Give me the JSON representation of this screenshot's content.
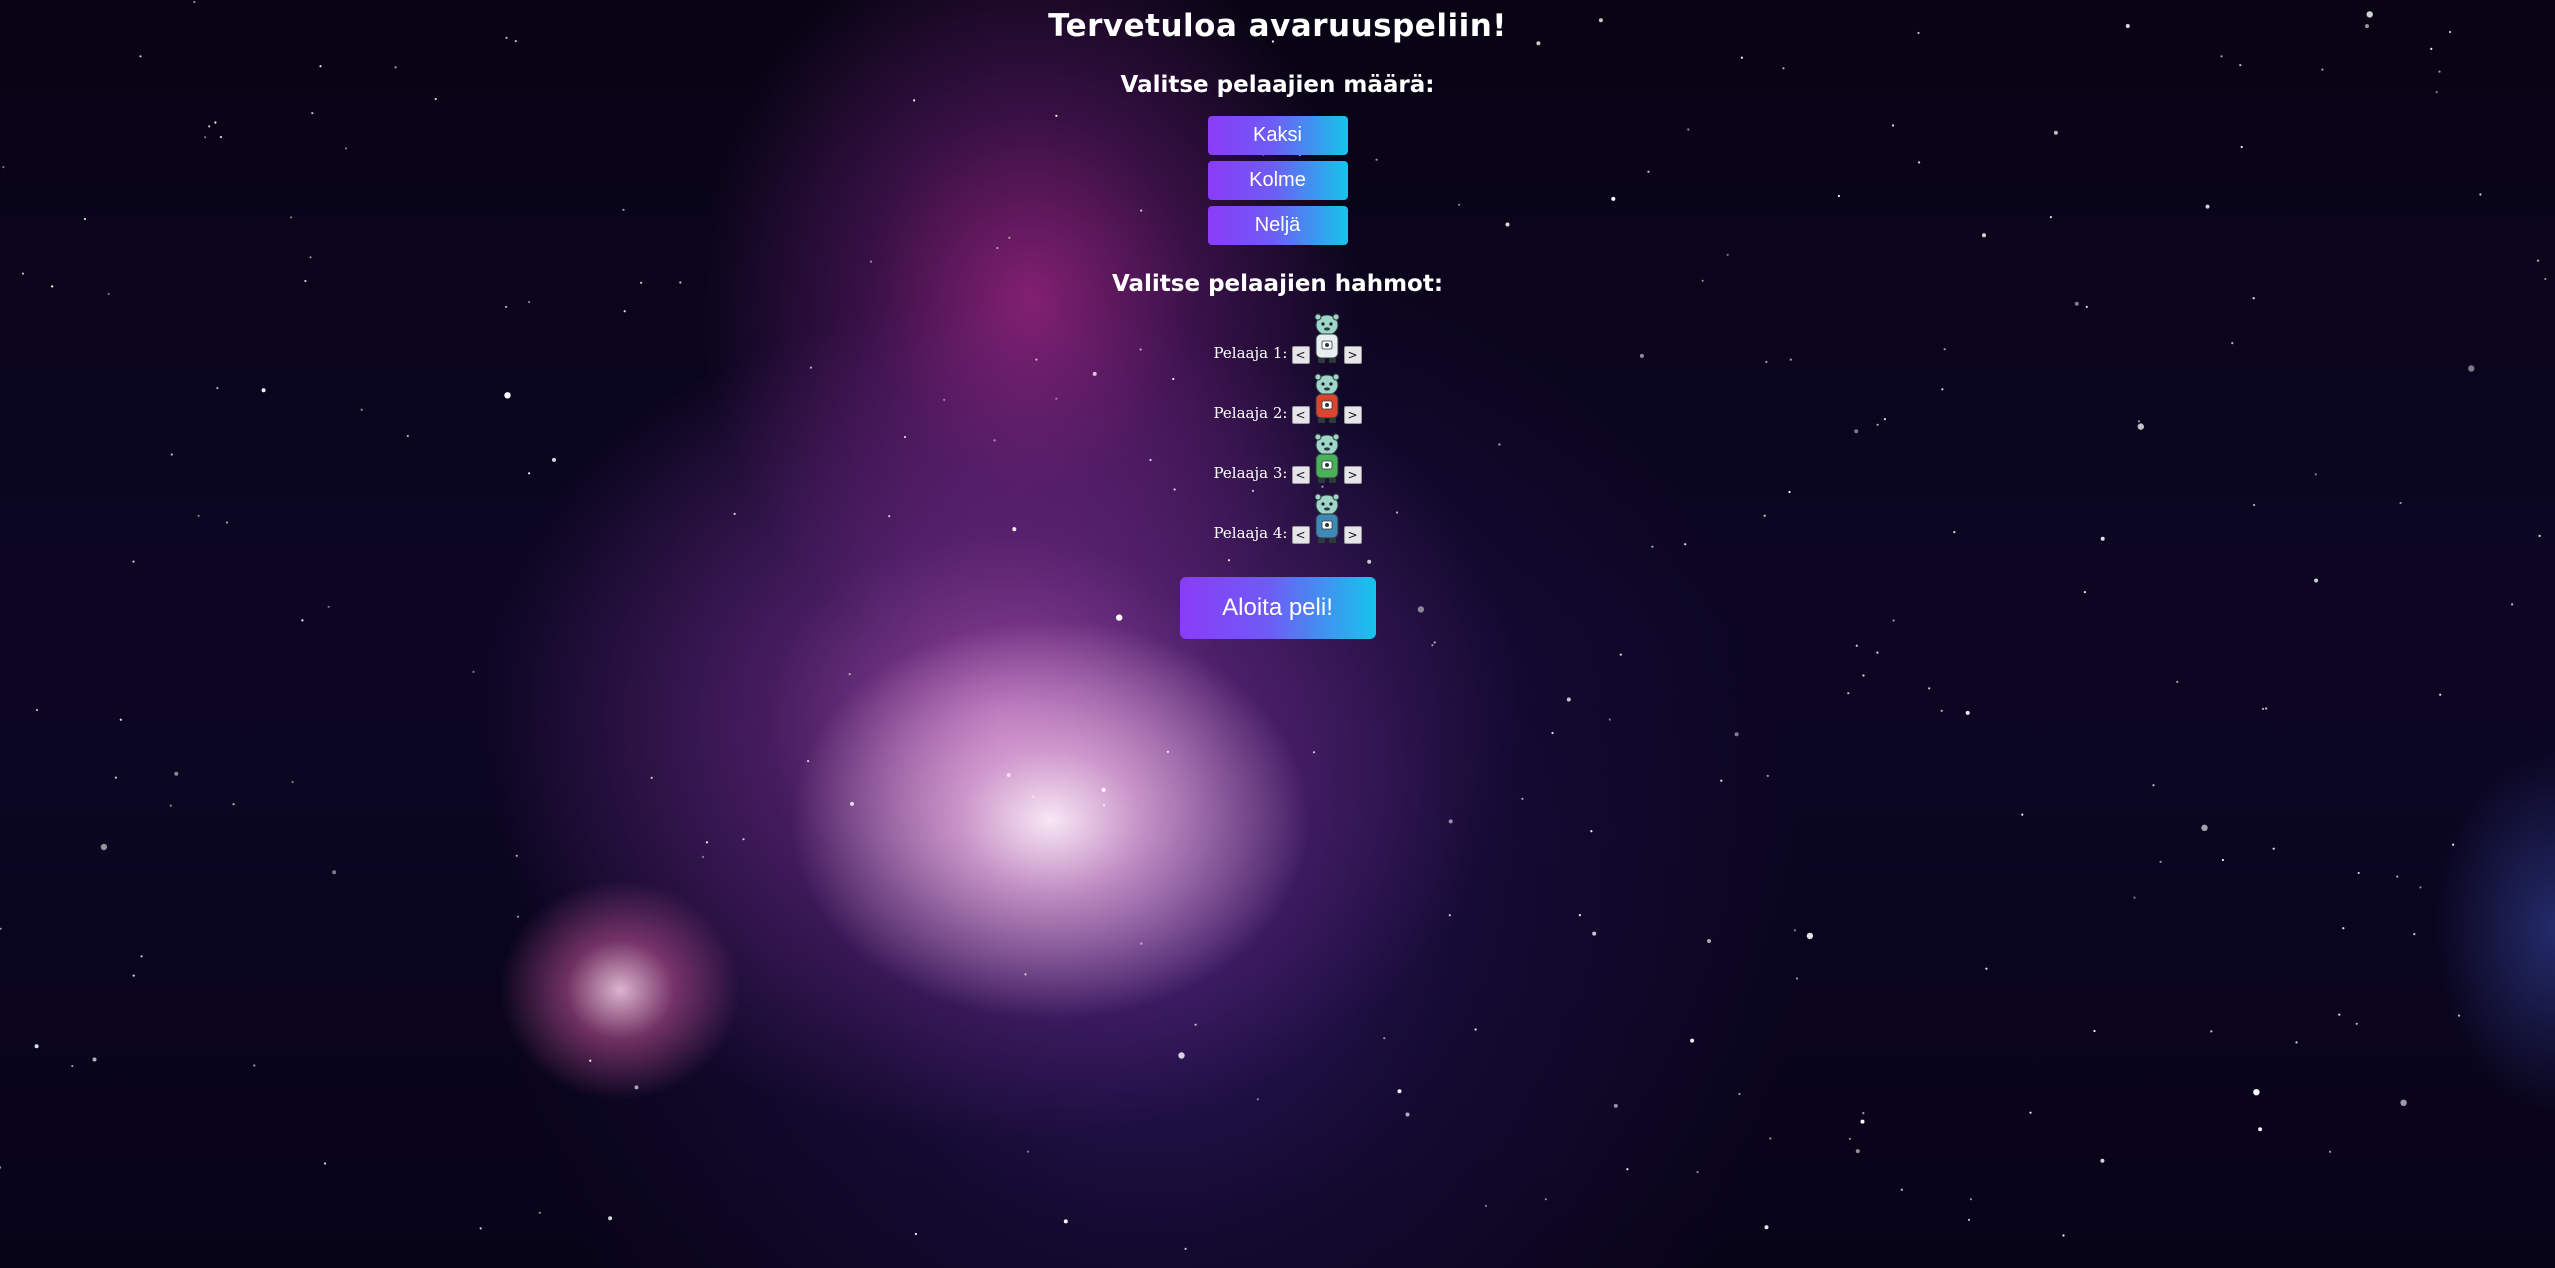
{
  "title": "Tervetuloa avaruuspeliin!",
  "player_count": {
    "heading": "Valitse pelaajien määrä:",
    "options": [
      "Kaksi",
      "Kolme",
      "Neljä"
    ]
  },
  "characters": {
    "heading": "Valitse pelaajien hahmot:",
    "prev_label": "<",
    "next_label": ">",
    "players": [
      {
        "label": "Pelaaja 1:",
        "icon": "white-suited-character-icon",
        "color": "#e8eef2"
      },
      {
        "label": "Pelaaja 2:",
        "icon": "red-suited-character-icon",
        "color": "#d9452f"
      },
      {
        "label": "Pelaaja 3:",
        "icon": "green-suited-character-icon",
        "color": "#4caf5a"
      },
      {
        "label": "Pelaaja 4:",
        "icon": "blue-suited-character-icon",
        "color": "#3f88b8"
      }
    ]
  },
  "start_button": "Aloita peli!",
  "colors": {
    "button_gradient_start": "#8a3cf7",
    "button_gradient_end": "#16c4ec"
  }
}
